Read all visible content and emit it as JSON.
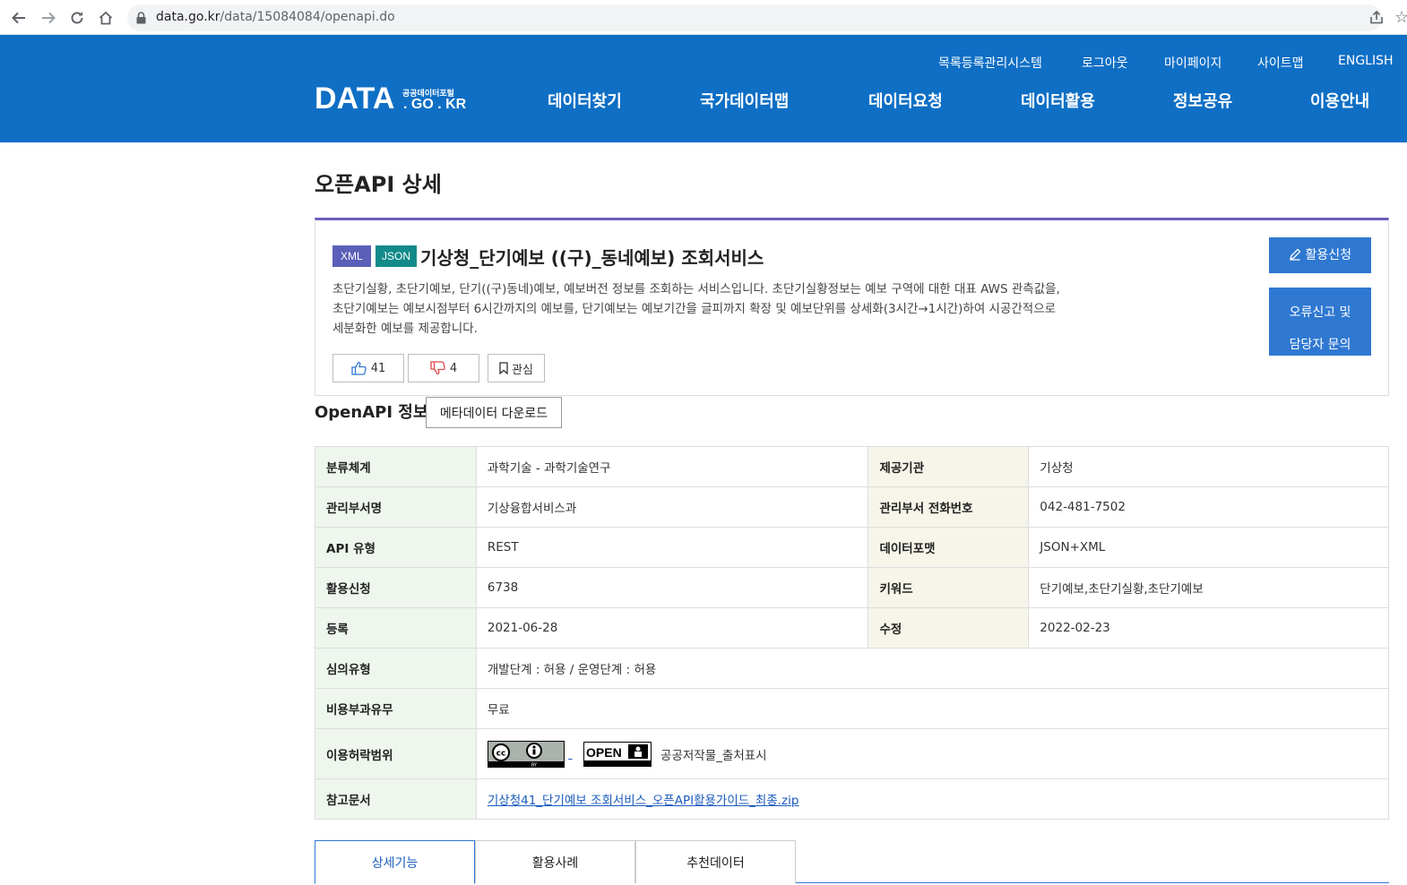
{
  "browser": {
    "url_host": "data.go.kr",
    "url_path": "/data/15084084/openapi.do"
  },
  "header": {
    "util_links": [
      "목록등록관리시스템",
      "로그아웃",
      "마이페이지",
      "사이트맵",
      "ENGLISH"
    ],
    "logo": {
      "main": "DATA",
      "sub": "공공데이터포털",
      "domain": ". GO . KR"
    },
    "nav": [
      "데이터찾기",
      "국가데이터맵",
      "데이터요청",
      "데이터활용",
      "정보공유",
      "이용안내"
    ]
  },
  "page": {
    "title": "오픈API 상세"
  },
  "summary": {
    "badges": [
      "XML",
      "JSON"
    ],
    "title": "기상청_단기예보 ((구)_동네예보) 조회서비스",
    "description_lines": [
      "초단기실황, 초단기예보, 단기((구)동네)예보, 예보버전 정보를 조회하는 서비스입니다. 초단기실황정보는 예보 구역에 대한 대표 AWS 관측값을,",
      "초단기예보는 예보시점부터 6시간까지의 예보를, 단기예보는 예보기간을 글피까지 확장 및 예보단위를 상세화(3시간→1시간)하여 시공간적으로",
      "세분화한 예보를 제공합니다."
    ],
    "likes": "41",
    "dislikes": "4",
    "bookmark_label": "관심",
    "apply_button": "활용신청",
    "report_button_line1": "오류신고 및",
    "report_button_line2": "담당자 문의"
  },
  "openapi_info": {
    "section_title": "OpenAPI 정보",
    "metadata_button": "메타데이터 다운로드",
    "rows": [
      {
        "l1": "분류체계",
        "v1": "과학기술 - 과학기술연구",
        "l2": "제공기관",
        "v2": "기상청"
      },
      {
        "l1": "관리부서명",
        "v1": "기상융합서비스과",
        "l2": "관리부서 전화번호",
        "v2": "042-481-7502"
      },
      {
        "l1": "API 유형",
        "v1": "REST",
        "l2": "데이터포맷",
        "v2": "JSON+XML"
      },
      {
        "l1": "활용신청",
        "v1": "6738",
        "l2": "키워드",
        "v2": "단기예보,초단기실황,초단기예보"
      },
      {
        "l1": "등록",
        "v1": "2021-06-28",
        "l2": "수정",
        "v2": "2022-02-23"
      }
    ],
    "review_type_label": "심의유형",
    "review_type_value": "개발단계 : 허용 / 운영단계 : 허용",
    "fee_label": "비용부과유무",
    "fee_value": "무료",
    "license_label": "이용허락범위",
    "license_value": "공공저작물_출처표시",
    "cc_badge_text": "BY",
    "open_badge_text": "OPEN",
    "reference_label": "참고문서",
    "reference_link": "기상청41_단기예보 조회서비스_오픈API활용가이드_최종.zip"
  },
  "tabs": [
    "상세기능",
    "활용사례",
    "추천데이터"
  ],
  "colors": {
    "header_bg": "#0f6fc5",
    "xml_badge": "#5b5fb8",
    "json_badge": "#138a8a",
    "summary_top_border": "#6c5ebc",
    "button_blue": "#2f78d1"
  }
}
